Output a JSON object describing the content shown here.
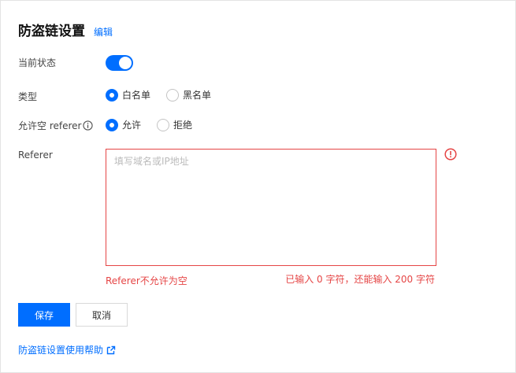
{
  "header": {
    "title": "防盗链设置",
    "edit_label": "编辑"
  },
  "status": {
    "label": "当前状态",
    "enabled": true
  },
  "type": {
    "label": "类型",
    "options": [
      {
        "label": "白名单",
        "checked": true
      },
      {
        "label": "黑名单",
        "checked": false
      }
    ]
  },
  "allow_empty": {
    "label": "允许空 referer",
    "options": [
      {
        "label": "允许",
        "checked": true
      },
      {
        "label": "拒绝",
        "checked": false
      }
    ]
  },
  "referer": {
    "label": "Referer",
    "placeholder": "填写域名或IP地址",
    "value": "",
    "error": "Referer不允许为空",
    "count_text": "已输入 0 字符，还能输入 200 字符"
  },
  "actions": {
    "save_label": "保存",
    "cancel_label": "取消"
  },
  "help": {
    "label": "防盗链设置使用帮助"
  },
  "colors": {
    "accent": "#006eff",
    "error": "#e54545"
  }
}
